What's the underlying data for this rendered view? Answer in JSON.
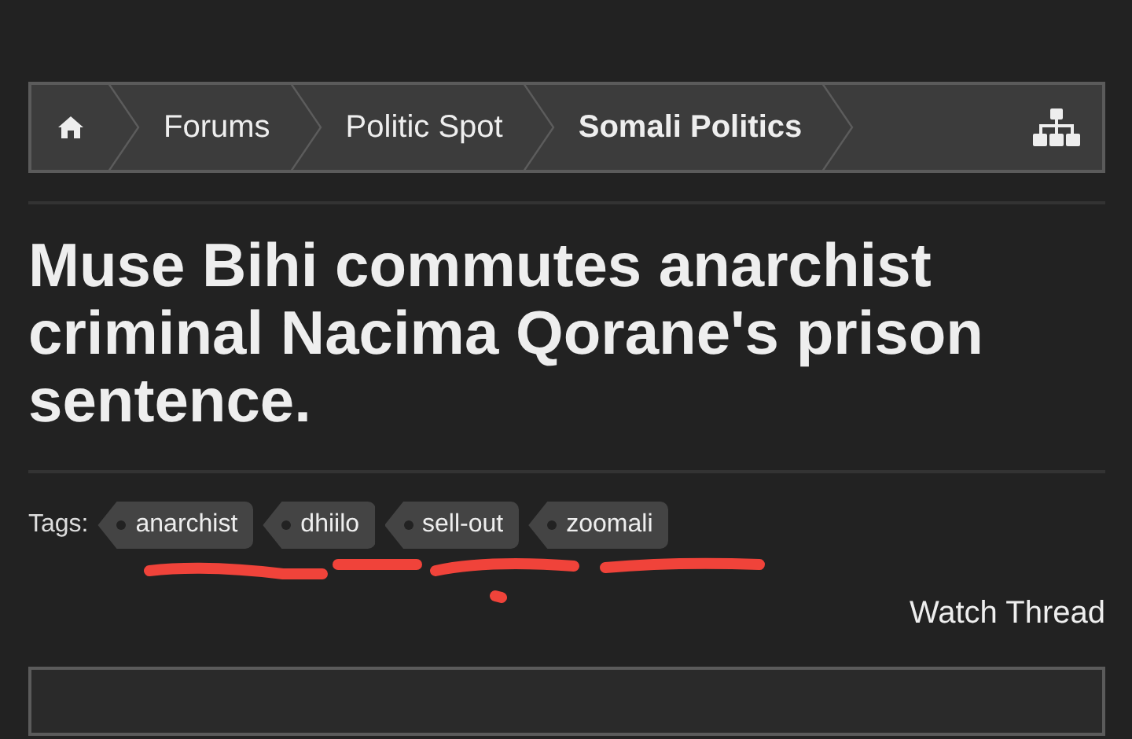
{
  "breadcrumb": {
    "items": [
      {
        "kind": "home"
      },
      {
        "kind": "link",
        "label": "Forums",
        "selected": false
      },
      {
        "kind": "link",
        "label": "Politic Spot",
        "selected": false
      },
      {
        "kind": "link",
        "label": "Somali Politics",
        "selected": true
      }
    ]
  },
  "title": "Muse Bihi commutes anarchist criminal Nacima Qorane's prison sentence.",
  "tags": {
    "label": "Tags:",
    "items": [
      "anarchist",
      "dhiilo",
      "sell-out",
      "zoomali"
    ]
  },
  "watch": "Watch Thread"
}
